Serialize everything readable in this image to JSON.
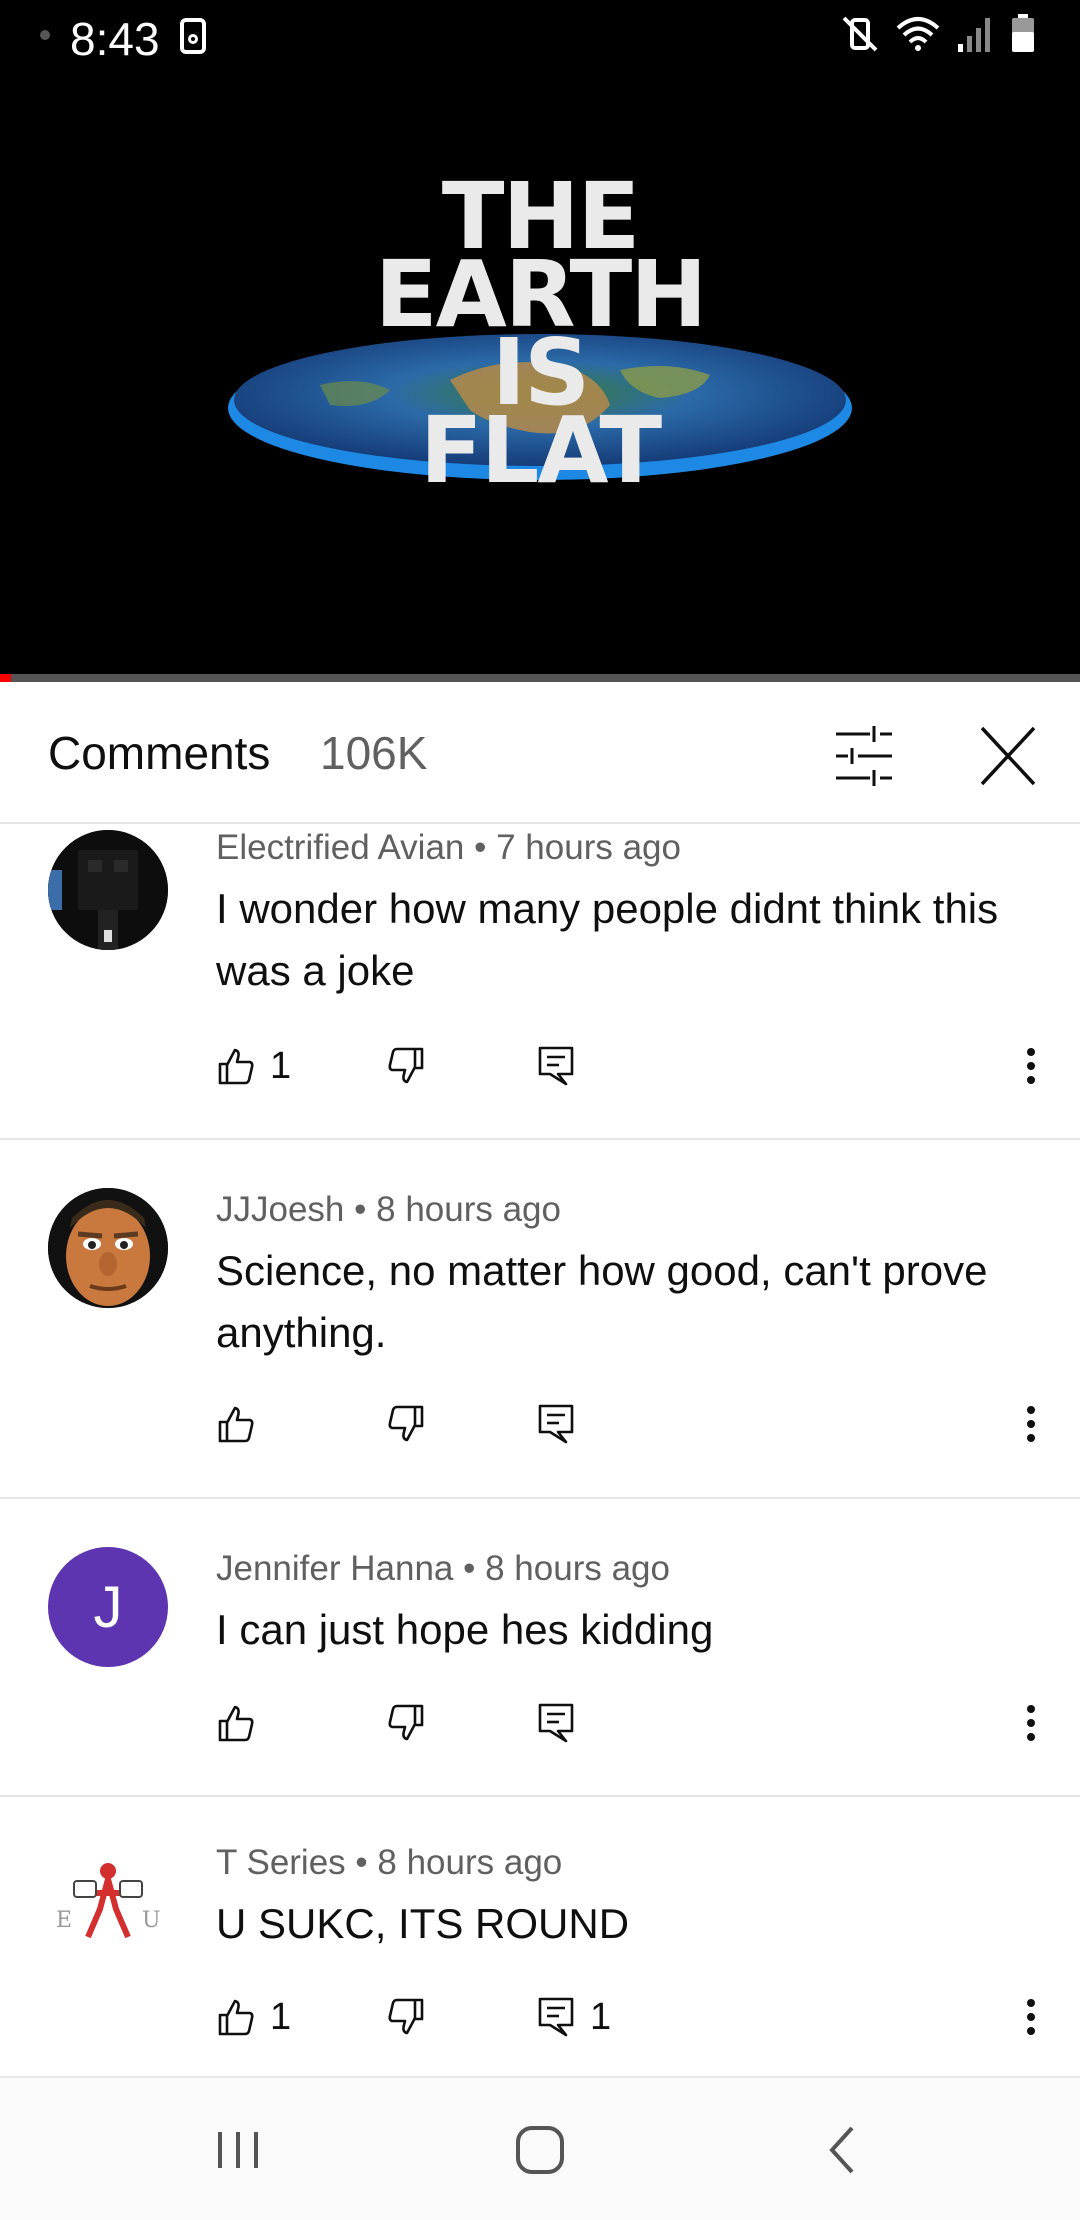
{
  "status_bar": {
    "time": "8:43"
  },
  "video": {
    "thumbnail_text": [
      "THE",
      "EARTH",
      "IS",
      "FLAT"
    ],
    "progress_fraction": 0.01
  },
  "comments_panel": {
    "title": "Comments",
    "count": "106K",
    "sort_icon": "sliders-icon",
    "close_icon": "close-icon"
  },
  "comments": [
    {
      "author": "Electrified Avian",
      "time": "7 hours ago",
      "text": "I wonder how many people didnt think this was a joke",
      "likes": "1",
      "replies": "",
      "avatar": "pixel-figure-avatar"
    },
    {
      "author": "JJJoesh",
      "time": "8 hours ago",
      "text": "Science, no matter how good, can't prove anything.",
      "likes": "",
      "replies": "",
      "avatar": "cartoon-face-avatar"
    },
    {
      "author": "Jennifer Hanna",
      "time": "8 hours ago",
      "text": "I can just hope hes kidding",
      "likes": "",
      "replies": "",
      "avatar_letter": "J",
      "avatar_color": "#5e35b1"
    },
    {
      "author": "T Series",
      "time": "8 hours ago",
      "text": "U SUKC, ITS ROUND",
      "likes": "1",
      "replies": "1",
      "avatar": "logo-avatar"
    }
  ],
  "colors": {
    "progress": "#ff0000",
    "meta_text": "#606060",
    "divider": "#e5e5e5"
  }
}
